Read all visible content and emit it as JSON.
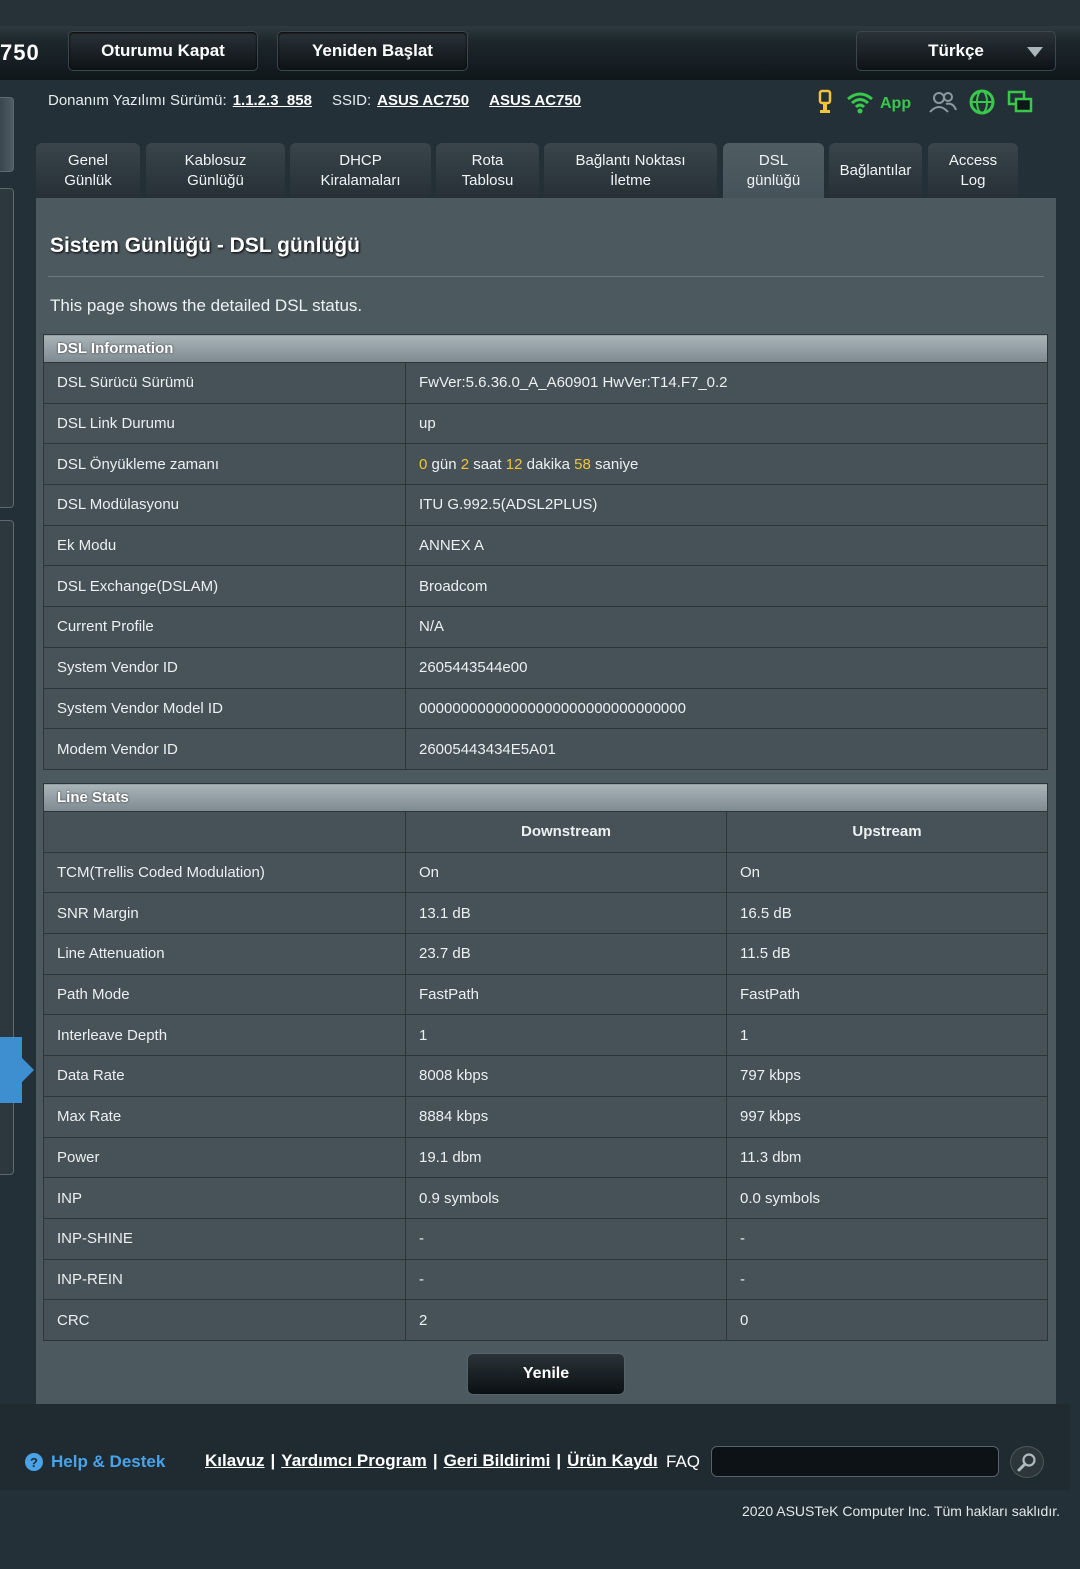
{
  "header": {
    "model_fragment": "750",
    "logout_label": "Oturumu Kapat",
    "reboot_label": "Yeniden Başlat",
    "language": "Türkçe",
    "firmware_label": "Donanım Yazılımı Sürümü:",
    "firmware_version": "1.1.2.3_858",
    "ssid_label": "SSID:",
    "ssid_1": "ASUS AC750",
    "ssid_2": "ASUS AC750",
    "app_label": "App",
    "icons": [
      "usb-icon",
      "wifi-icon",
      "clients-icon",
      "internet-globe-icon",
      "network-status-icon"
    ]
  },
  "tabs": [
    {
      "l1": "Genel",
      "l2": "Günlük"
    },
    {
      "l1": "Kablosuz",
      "l2": "Günlüğü"
    },
    {
      "l1": "DHCP",
      "l2": "Kiralamaları"
    },
    {
      "l1": "Rota",
      "l2": "Tablosu"
    },
    {
      "l1": "Bağlantı Noktası",
      "l2": "İletme"
    },
    {
      "l1": "DSL",
      "l2": "günlüğü"
    },
    {
      "l1": "Bağlantılar",
      "l2": ""
    },
    {
      "l1": "Access",
      "l2": "Log"
    }
  ],
  "page": {
    "title": "Sistem Günlüğü - DSL günlüğü",
    "description": "This page shows the detailed DSL status."
  },
  "dsl_info": {
    "section_title": "DSL Information",
    "rows": [
      {
        "label": "DSL Sürücü Sürümü",
        "value": "FwVer:5.6.36.0_A_A60901 HwVer:T14.F7_0.2"
      },
      {
        "label": "DSL Link Durumu",
        "value": "up"
      },
      {
        "label": "DSL Önyükleme zamanı",
        "value": ""
      },
      {
        "label": "DSL Modülasyonu",
        "value": "ITU G.992.5(ADSL2PLUS)"
      },
      {
        "label": "Ek Modu",
        "value": "ANNEX A"
      },
      {
        "label": "DSL Exchange(DSLAM)",
        "value": "Broadcom"
      },
      {
        "label": "Current Profile",
        "value": "N/A"
      },
      {
        "label": "System Vendor ID",
        "value": "2605443544e00"
      },
      {
        "label": "System Vendor Model ID",
        "value": "00000000000000000000000000000000"
      },
      {
        "label": "Modem Vendor ID",
        "value": "26005443434E5A01"
      }
    ],
    "uptime": {
      "days": "0",
      "days_unit": "gün",
      "hours": "2",
      "hours_unit": "saat",
      "minutes": "12",
      "minutes_unit": "dakika",
      "seconds": "58",
      "seconds_unit": "saniye"
    }
  },
  "line_stats": {
    "section_title": "Line Stats",
    "col_down": "Downstream",
    "col_up": "Upstream",
    "rows": [
      {
        "label": "TCM(Trellis Coded Modulation)",
        "down": "On",
        "up": "On"
      },
      {
        "label": "SNR Margin",
        "down": "13.1 dB",
        "up": "16.5 dB"
      },
      {
        "label": "Line Attenuation",
        "down": "23.7 dB",
        "up": "11.5 dB"
      },
      {
        "label": "Path Mode",
        "down": "FastPath",
        "up": "FastPath"
      },
      {
        "label": "Interleave Depth",
        "down": "1",
        "up": "1"
      },
      {
        "label": "Data Rate",
        "down": "8008 kbps",
        "up": "797 kbps"
      },
      {
        "label": "Max Rate",
        "down": "8884 kbps",
        "up": "997 kbps"
      },
      {
        "label": "Power",
        "down": "19.1 dbm",
        "up": "11.3 dbm"
      },
      {
        "label": "INP",
        "down": "0.9 symbols",
        "up": "0.0 symbols"
      },
      {
        "label": "INP-SHINE",
        "down": "-",
        "up": "-"
      },
      {
        "label": "INP-REIN",
        "down": "-",
        "up": "-"
      },
      {
        "label": "CRC",
        "down": "2",
        "up": "0"
      }
    ]
  },
  "refresh_label": "Yenile",
  "footer": {
    "help_label": "Help & Destek",
    "link_manual": "Kılavuz",
    "link_utility": "Yardımcı Program",
    "link_feedback": "Geri Bildirimi",
    "link_register": "Ürün Kaydı",
    "separator": "|",
    "faq_label": "FAQ",
    "faq_value": "",
    "copyright": "2020 ASUSTeK Computer Inc. Tüm hakları saklıdır."
  },
  "colors": {
    "accent_blue": "#4aa3e8",
    "highlight_yellow": "#f3c33b",
    "status_green": "#38c94a"
  }
}
